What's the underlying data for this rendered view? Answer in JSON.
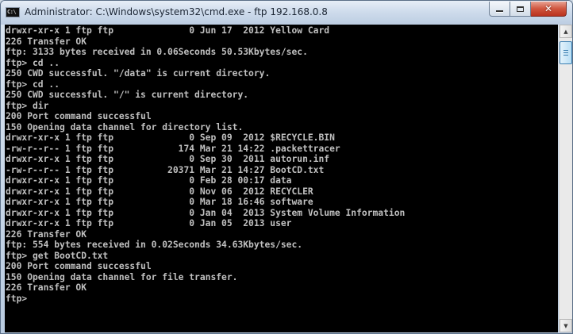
{
  "window": {
    "title": "Administrator: C:\\Windows\\system32\\cmd.exe - ftp  192.168.0.8",
    "icon_glyph": "C:\\"
  },
  "controls": {
    "minimize": "minimize-icon",
    "maximize": "maximize-icon",
    "close": "close-icon",
    "close_glyph": "✕"
  },
  "scrollbar": {
    "up_glyph": "▲",
    "down_glyph": "▼"
  },
  "console": {
    "lines": [
      "drwxr-xr-x 1 ftp ftp              0 Jun 17  2012 Yellow Card",
      "226 Transfer OK",
      "ftp: 3133 bytes received in 0.06Seconds 50.53Kbytes/sec.",
      "ftp> cd ..",
      "250 CWD successful. \"/data\" is current directory.",
      "ftp> cd ..",
      "250 CWD successful. \"/\" is current directory.",
      "ftp> dir",
      "200 Port command successful",
      "150 Opening data channel for directory list.",
      "drwxr-xr-x 1 ftp ftp              0 Sep 09  2012 $RECYCLE.BIN",
      "-rw-r--r-- 1 ftp ftp            174 Mar 21 14:22 .packettracer",
      "drwxr-xr-x 1 ftp ftp              0 Sep 30  2011 autorun.inf",
      "-rw-r--r-- 1 ftp ftp          20371 Mar 21 14:27 BootCD.txt",
      "drwxr-xr-x 1 ftp ftp              0 Feb 28 00:17 data",
      "drwxr-xr-x 1 ftp ftp              0 Nov 06  2012 RECYCLER",
      "drwxr-xr-x 1 ftp ftp              0 Mar 18 16:46 software",
      "drwxr-xr-x 1 ftp ftp              0 Jan 04  2013 System Volume Information",
      "drwxr-xr-x 1 ftp ftp              0 Jan 05  2013 user",
      "226 Transfer OK",
      "ftp: 554 bytes received in 0.02Seconds 34.63Kbytes/sec.",
      "ftp> get BootCD.txt",
      "200 Port command successful",
      "150 Opening data channel for file transfer.",
      "226 Transfer OK",
      "ftp> "
    ]
  }
}
